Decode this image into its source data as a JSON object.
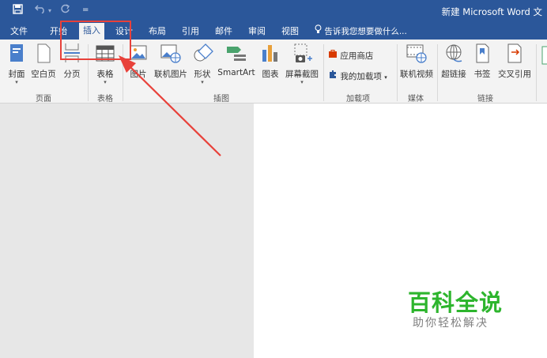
{
  "window": {
    "title": "新建 Microsoft Word 文"
  },
  "quick_access": {
    "save_icon": "save-icon",
    "undo_icon": "undo-icon",
    "redo_icon": "redo-icon",
    "customize": "="
  },
  "tabs": [
    {
      "label": "文件"
    },
    {
      "label": "开始"
    },
    {
      "label": "插入"
    },
    {
      "label": "设计"
    },
    {
      "label": "布局"
    },
    {
      "label": "引用"
    },
    {
      "label": "邮件"
    },
    {
      "label": "审阅"
    },
    {
      "label": "视图"
    }
  ],
  "tellme": {
    "text": "告诉我您想要做什么..."
  },
  "ribbon": {
    "pages": {
      "group": "页面",
      "cover": "封面",
      "blank": "空白页",
      "break": "分页"
    },
    "tables": {
      "group": "表格",
      "table": "表格"
    },
    "illustrations": {
      "group": "插图",
      "pictures": "图片",
      "online": "联机图片",
      "shapes": "形状",
      "smartart": "SmartArt",
      "chart": "图表",
      "screenshot": "屏幕截图"
    },
    "addins": {
      "group": "加载项",
      "store": "应用商店",
      "myaddins": "我的加载项"
    },
    "media": {
      "group": "媒体",
      "video": "联机视频"
    },
    "links": {
      "group": "链接",
      "hyperlink": "超链接",
      "bookmark": "书签",
      "crossref": "交叉引用"
    }
  },
  "watermark": {
    "title": "百科全说",
    "subtitle": "助你轻松解决"
  },
  "colors": {
    "accent": "#2b579a",
    "highlight": "#e8413a",
    "watermark": "#2db52d"
  }
}
